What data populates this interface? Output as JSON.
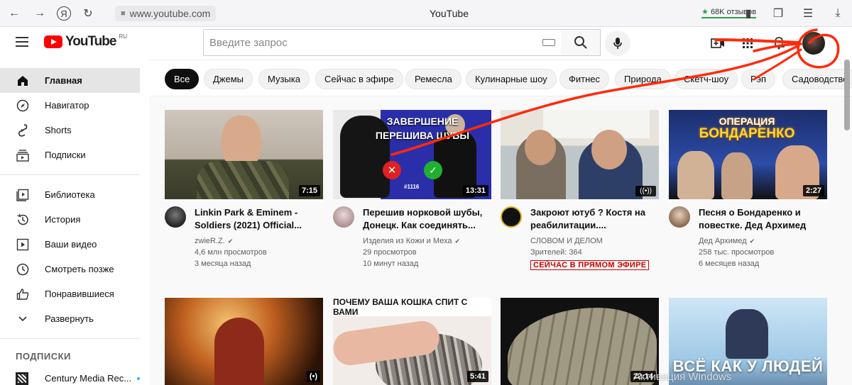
{
  "browser": {
    "url": "www.youtube.com",
    "tab_title": "YouTube",
    "reviews": "68K отзывов"
  },
  "header": {
    "logo_text": "YouTube",
    "region": "RU",
    "search_placeholder": "Введите запрос"
  },
  "sidebar": {
    "main": [
      {
        "label": "Главная",
        "icon": "home-icon"
      },
      {
        "label": "Навигатор",
        "icon": "compass-icon"
      },
      {
        "label": "Shorts",
        "icon": "shorts-icon"
      },
      {
        "label": "Подписки",
        "icon": "subscriptions-icon"
      }
    ],
    "library": [
      {
        "label": "Библиотека",
        "icon": "library-icon"
      },
      {
        "label": "История",
        "icon": "history-icon"
      },
      {
        "label": "Ваши видео",
        "icon": "your-videos-icon"
      },
      {
        "label": "Смотреть позже",
        "icon": "watch-later-icon"
      },
      {
        "label": "Понравившиеся",
        "icon": "thumbs-up-icon"
      },
      {
        "label": "Развернуть",
        "icon": "chevron-down-icon"
      }
    ],
    "subscriptions_heading": "ПОДПИСКИ",
    "channels": [
      {
        "label": "Century Media Rec..."
      }
    ]
  },
  "chips": [
    "Все",
    "Джемы",
    "Музыка",
    "Сейчас в эфире",
    "Ремесла",
    "Кулинарные шоу",
    "Фитнес",
    "Природа",
    "Скетч-шоу",
    "Рэп",
    "Садоводство"
  ],
  "videos": [
    {
      "title": "Linkin Park & Eminem - Soldiers (2021) Official...",
      "channel": "zwieR.Z.",
      "verified": true,
      "views": "4,6 млн просмотров",
      "age": "3 месяца назад",
      "duration": "7:15"
    },
    {
      "title": "Перешив норковой шубы, Донецк. Как соединять...",
      "channel": "Изделия из Кожи и Меха",
      "verified": true,
      "views": "29 просмотров",
      "age": "10 минут назад",
      "duration": "13:31",
      "thumb_caption": "ЗАВЕРШЕНИЕ ПЕРЕШИВА ШУБЫ",
      "thumb_num": "#1116"
    },
    {
      "title": "Закроют ютуб ? Костя на реабилитации....",
      "channel": "СЛОВОМ И ДЕЛОМ",
      "verified": false,
      "views": "Зрителей: 364",
      "live": "СЕЙЧАС В ПРЯМОМ ЭФИРЕ"
    },
    {
      "title": "Песня о Бондаренко и повестке. Дед Архимед",
      "channel": "Дед Архимед",
      "verified": true,
      "views": "258 тыс. просмотров",
      "age": "6 месяцев назад",
      "duration": "2:27",
      "thumb_caption_1": "ОПЕРАЦИЯ",
      "thumb_caption_2": "БОНДАРЕНКО"
    },
    {
      "duration": "(•)"
    },
    {
      "duration": "5:41",
      "thumb_caption": "ПОЧЕМУ ВАША КОШКА СПИТ С ВАМИ"
    },
    {
      "duration": "22:14"
    },
    {
      "thumb_caption": "ВСЁ КАК У ЛЮДЕЙ"
    }
  ],
  "watermark": "Активация Windows"
}
